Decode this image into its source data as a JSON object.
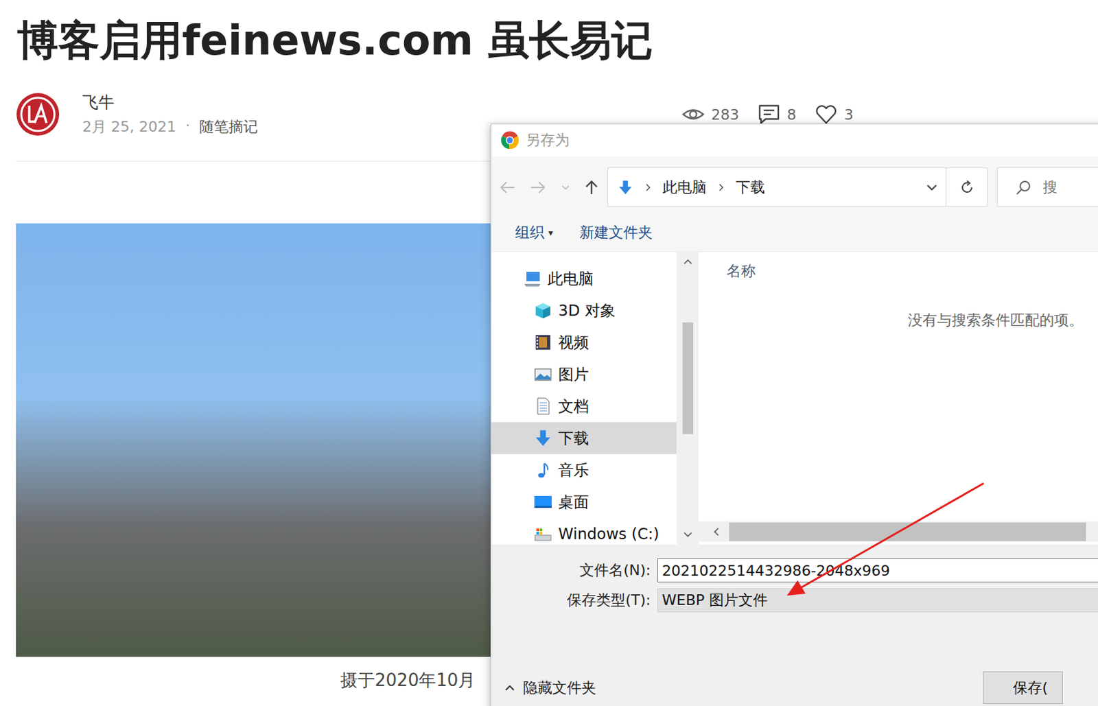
{
  "page": {
    "title": "博客启用feinews.com 虽长易记",
    "author": "飞牛",
    "date": "2月 25, 2021",
    "separator": "·",
    "category": "随笔摘记",
    "stats": [
      {
        "kind": "views",
        "value": "283"
      },
      {
        "kind": "comments",
        "value": "8"
      },
      {
        "kind": "likes",
        "value": "3"
      }
    ],
    "photo_caption": "摄于2020年10月"
  },
  "dialog": {
    "title": "另存为",
    "breadcrumb": [
      "此电脑",
      "下载"
    ],
    "search_placeholder": "搜",
    "toolbar": [
      {
        "label": "组织",
        "caret": "▾"
      },
      {
        "label": "新建文件夹",
        "caret": ""
      }
    ],
    "tree": [
      {
        "label": "此电脑",
        "kind": "computer",
        "level": 0,
        "selected": false
      },
      {
        "label": "3D 对象",
        "kind": "cube",
        "level": 1,
        "selected": false
      },
      {
        "label": "视频",
        "kind": "video",
        "level": 1,
        "selected": false
      },
      {
        "label": "图片",
        "kind": "picture",
        "level": 1,
        "selected": false
      },
      {
        "label": "文档",
        "kind": "document",
        "level": 1,
        "selected": false
      },
      {
        "label": "下载",
        "kind": "download",
        "level": 1,
        "selected": true
      },
      {
        "label": "音乐",
        "kind": "music",
        "level": 1,
        "selected": false
      },
      {
        "label": "桌面",
        "kind": "desktop",
        "level": 1,
        "selected": false
      },
      {
        "label": "Windows (C:)",
        "kind": "drive",
        "level": 1,
        "selected": false
      }
    ],
    "column_header": "名称",
    "empty_message": "没有与搜索条件匹配的项。",
    "fields": [
      {
        "label": "文件名(N):",
        "value": "2021022514432986-2048x969",
        "kind": "input"
      },
      {
        "label": "保存类型(T):",
        "value": "WEBP 图片文件",
        "kind": "select"
      }
    ],
    "hide_folders": "隐藏文件夹",
    "save_button": "保存("
  }
}
